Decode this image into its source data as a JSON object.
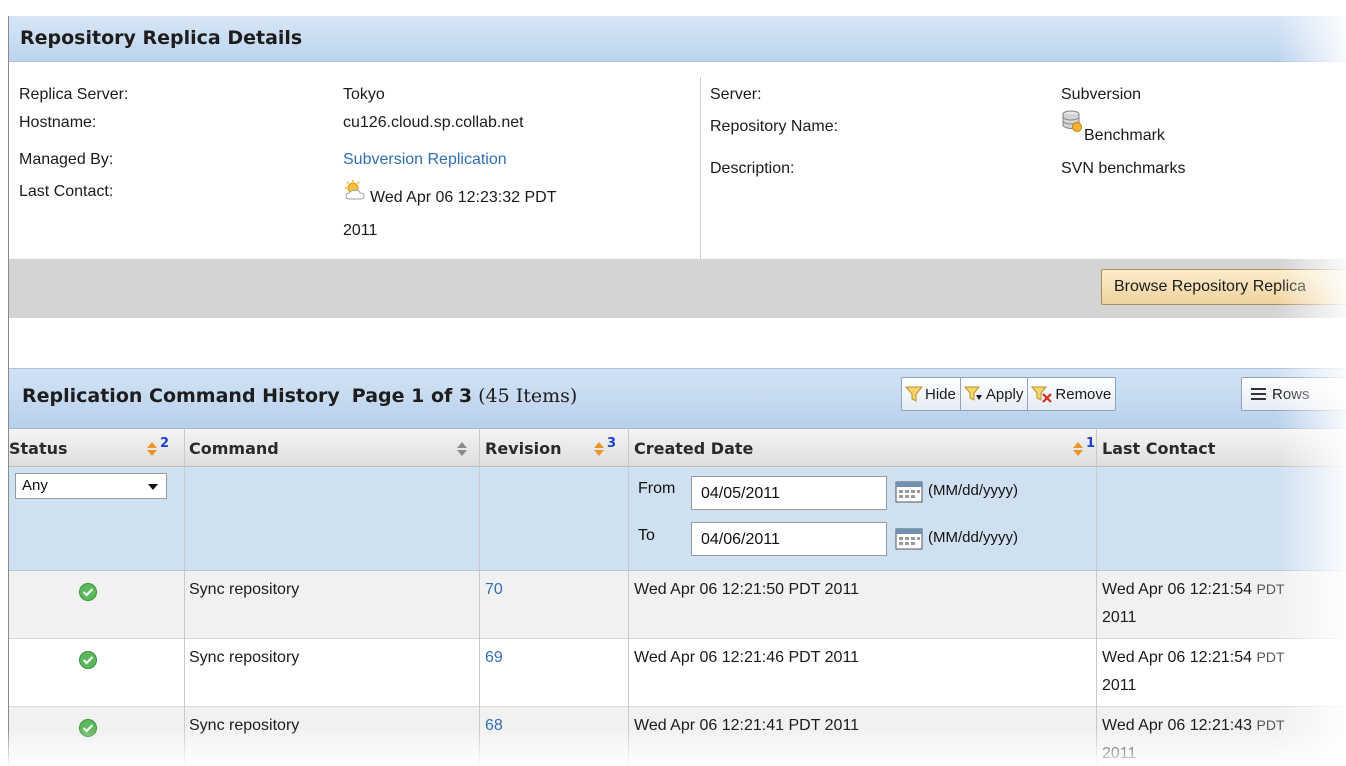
{
  "details": {
    "title": "Repository Replica Details",
    "left": {
      "replica_server_label": "Replica Server:",
      "replica_server_value": "Tokyo",
      "hostname_label": "Hostname:",
      "hostname_value": "cu126.cloud.sp.collab.net",
      "managed_by_label": "Managed By:",
      "managed_by_value": "Subversion Replication",
      "last_contact_label": "Last Contact:",
      "last_contact_line1": "Wed Apr 06 12:23:32 PDT",
      "last_contact_line2": "2011",
      "last_contact_icon": "partly-cloudy-icon"
    },
    "right": {
      "server_label": "Server:",
      "server_value": "Subversion",
      "repo_name_label": "Repository Name:",
      "repo_name_value": "Benchmark",
      "repo_icon": "database-icon",
      "description_label": "Description:",
      "description_value": "SVN benchmarks"
    },
    "browse_button": "Browse Repository Replica"
  },
  "history": {
    "title": "Replication Command History",
    "page_info": "Page 1 of 3",
    "items_count": "(45 Items)",
    "toolbar": {
      "hide": "Hide",
      "apply": "Apply",
      "remove": "Remove",
      "rows": "Rows"
    },
    "columns": {
      "status": "Status",
      "status_sort": "2",
      "command": "Command",
      "revision": "Revision",
      "revision_sort": "3",
      "created_date": "Created Date",
      "created_sort": "1",
      "last_contact": "Last Contact"
    },
    "filters": {
      "status_value": "Any",
      "from_label": "From",
      "from_value": "04/05/2011",
      "to_label": "To",
      "to_value": "04/06/2011",
      "date_format": "(MM/dd/yyyy)"
    },
    "rows": [
      {
        "command": "Sync repository",
        "revision": "70",
        "created": "Wed Apr 06 12:21:50 PDT 2011",
        "last_contact_a": "Wed Apr 06 12:21:54",
        "last_contact_b": "PDT",
        "last_contact_c": "2011"
      },
      {
        "command": "Sync repository",
        "revision": "69",
        "created": "Wed Apr 06 12:21:46 PDT 2011",
        "last_contact_a": "Wed Apr 06 12:21:54",
        "last_contact_b": "PDT",
        "last_contact_c": "2011"
      },
      {
        "command": "Sync repository",
        "revision": "68",
        "created": "Wed Apr 06 12:21:41 PDT 2011",
        "last_contact_a": "Wed Apr 06 12:21:43",
        "last_contact_b": "PDT",
        "last_contact_c": "2011"
      }
    ]
  },
  "colors": {
    "header_blue": "#c6daf1",
    "link_blue": "#2f6fb5",
    "success_green": "#5cb85c",
    "sort_orange": "#e8962a",
    "sort_number_blue": "#1e3fcf"
  }
}
